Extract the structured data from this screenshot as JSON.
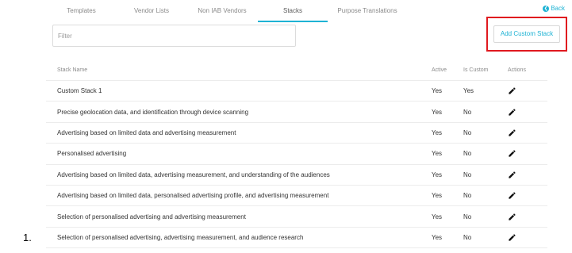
{
  "tabs": [
    {
      "label": "Templates",
      "active": false
    },
    {
      "label": "Vendor Lists",
      "active": false
    },
    {
      "label": "Non IAB Vendors",
      "active": false
    },
    {
      "label": "Stacks",
      "active": true
    },
    {
      "label": "Purpose Translations",
      "active": false
    }
  ],
  "back": {
    "label": "Back",
    "icon": "chevron-left-circle-icon"
  },
  "filter": {
    "placeholder": "Filter",
    "value": ""
  },
  "add_button": {
    "label": "Add Custom Stack"
  },
  "colors": {
    "accent": "#1fb3d4",
    "highlight": "#e0191f"
  },
  "table": {
    "headers": {
      "name": "Stack Name",
      "active": "Active",
      "is_custom": "Is Custom",
      "actions": "Actions"
    },
    "action_icon": "pencil-icon",
    "rows": [
      {
        "name": "Custom Stack 1",
        "active": "Yes",
        "is_custom": "Yes"
      },
      {
        "name": "Precise geolocation data, and identification through device scanning",
        "active": "Yes",
        "is_custom": "No"
      },
      {
        "name": "Advertising based on limited data and advertising measurement",
        "active": "Yes",
        "is_custom": "No"
      },
      {
        "name": "Personalised advertising",
        "active": "Yes",
        "is_custom": "No"
      },
      {
        "name": "Advertising based on limited data, advertising measurement, and understanding of the audiences",
        "active": "Yes",
        "is_custom": "No"
      },
      {
        "name": "Advertising based on limited data, personalised advertising profile, and advertising measurement",
        "active": "Yes",
        "is_custom": "No"
      },
      {
        "name": "Selection of personalised advertising and advertising measurement",
        "active": "Yes",
        "is_custom": "No"
      },
      {
        "name": "Selection of personalised advertising, advertising measurement, and audience research",
        "active": "Yes",
        "is_custom": "No"
      }
    ]
  },
  "list_marker": "1."
}
